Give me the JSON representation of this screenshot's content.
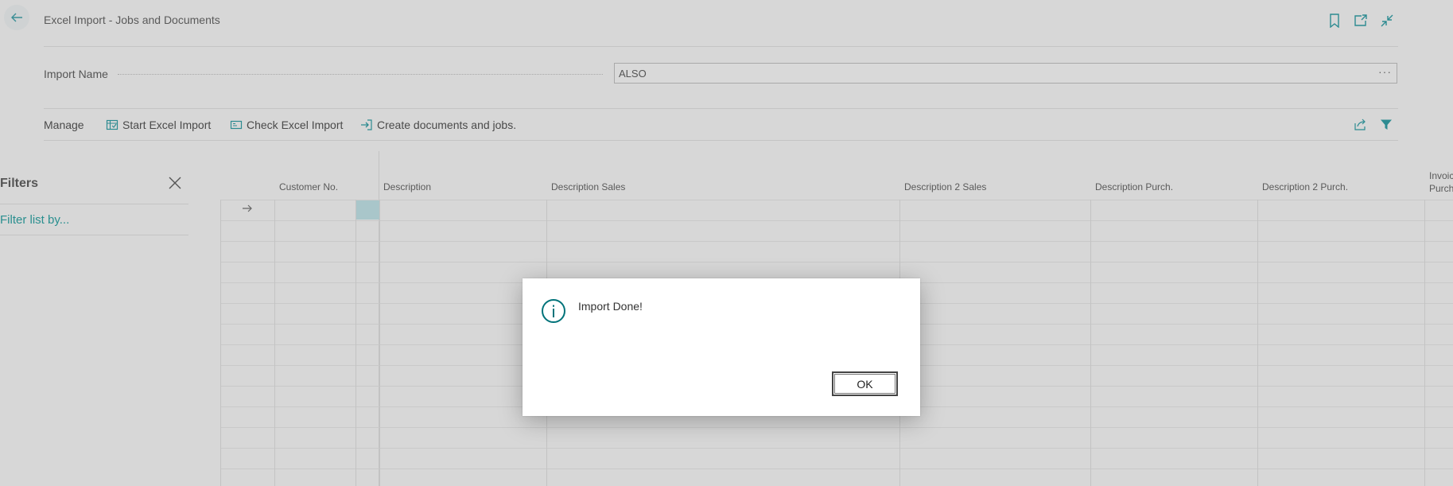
{
  "header": {
    "title": "Excel Import - Jobs and Documents",
    "icons": [
      "back-arrow-icon",
      "bookmark-icon",
      "open-new-window-icon",
      "collapse-icon"
    ]
  },
  "field": {
    "label": "Import Name",
    "value": "ALSO",
    "lookup": "···"
  },
  "actions": {
    "manage": "Manage",
    "start_import": "Start Excel Import",
    "check_import": "Check Excel Import",
    "create_docs": "Create documents and jobs.",
    "right_icons": [
      "share-icon",
      "filter-icon"
    ]
  },
  "filters": {
    "title": "Filters",
    "filter_link": "Filter list by..."
  },
  "grid": {
    "columns": [
      "Customer No.",
      "Description",
      "Description Sales",
      "Description 2 Sales",
      "Description Purch.",
      "Description 2 Purch.",
      "Invoic",
      "Purch"
    ]
  },
  "dialog": {
    "message": "Import Done!",
    "ok_label": "OK",
    "icon": "info-icon"
  },
  "colors": {
    "accent": "#00737a",
    "link": "#2a8f8f",
    "selection": "#a9c6ca"
  }
}
